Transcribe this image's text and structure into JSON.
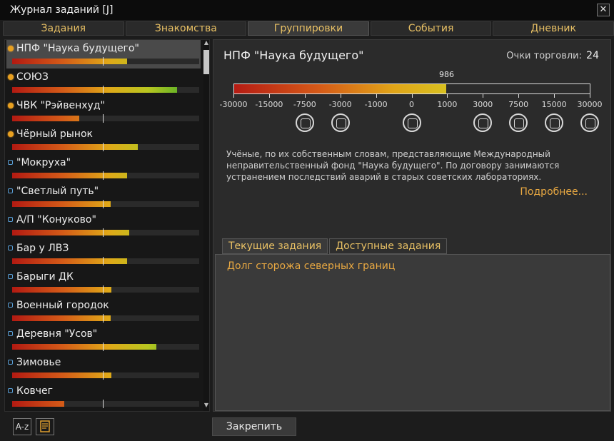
{
  "window": {
    "title": "Журнал заданий [J]",
    "close_glyph": "✕"
  },
  "tabs": [
    "Задания",
    "Знакомства",
    "Группировки",
    "События",
    "Дневник"
  ],
  "active_tab_index": 2,
  "factions": [
    {
      "name": "НПФ \"Наука будущего\"",
      "icon": "orange-gear-icon",
      "fill_pct": 61.5,
      "selected": true
    },
    {
      "name": "СОЮЗ",
      "icon": "orange-gear-icon",
      "fill_pct": 88
    },
    {
      "name": "ЧВК \"Рэйвенхуд\"",
      "icon": "orange-gear-icon",
      "fill_pct": 36
    },
    {
      "name": "Чёрный рынок",
      "icon": "orange-gear-icon",
      "fill_pct": 67
    },
    {
      "name": "\"Мокруха\"",
      "icon": "blue-house-icon",
      "fill_pct": 61.5
    },
    {
      "name": "\"Светлый путь\"",
      "icon": "blue-house-icon",
      "fill_pct": 52.5
    },
    {
      "name": "А/П \"Конуково\"",
      "icon": "blue-house-icon",
      "fill_pct": 62.5
    },
    {
      "name": "Бар у ЛВЗ",
      "icon": "blue-house-icon",
      "fill_pct": 61.5
    },
    {
      "name": "Барыги ДК",
      "icon": "blue-house-icon",
      "fill_pct": 53
    },
    {
      "name": "Военный городок",
      "icon": "blue-house-icon",
      "fill_pct": 52.5
    },
    {
      "name": "Деревня \"Усов\"",
      "icon": "blue-house-icon",
      "fill_pct": 77
    },
    {
      "name": "Зимовье",
      "icon": "blue-house-icon",
      "fill_pct": 53
    },
    {
      "name": "Ковчег",
      "icon": "blue-house-icon",
      "fill_pct": 28
    }
  ],
  "bottom_left": {
    "sort_label": "A-z",
    "filter_icon": "list-filter-icon"
  },
  "detail": {
    "title": "НПФ \"Наука будущего\"",
    "trade_label": "Очки торговли:",
    "trade_value": "24",
    "reputation": {
      "value": "986",
      "fill_pct": 59.6
    },
    "ticks": [
      {
        "label": "-30000",
        "pos": 0
      },
      {
        "label": "-15000",
        "pos": 10
      },
      {
        "label": "-7500",
        "pos": 20
      },
      {
        "label": "-3000",
        "pos": 30
      },
      {
        "label": "-1000",
        "pos": 40
      },
      {
        "label": "0",
        "pos": 50
      },
      {
        "label": "1000",
        "pos": 60
      },
      {
        "label": "3000",
        "pos": 70
      },
      {
        "label": "7500",
        "pos": 80
      },
      {
        "label": "15000",
        "pos": 90
      },
      {
        "label": "30000",
        "pos": 100
      }
    ],
    "rank_icons": [
      {
        "name": "skull-icon",
        "pos": 20
      },
      {
        "name": "biohazard-icon",
        "pos": 30
      },
      {
        "name": "handshake-icon",
        "pos": 50
      },
      {
        "name": "checklist-icon",
        "pos": 70
      },
      {
        "name": "trade-locked-icon",
        "pos": 80
      },
      {
        "name": "document-icon",
        "pos": 90
      },
      {
        "name": "ledger-icon",
        "pos": 100
      }
    ],
    "description": "Учёные, по их собственным словам, представляющие Международный неправительственный фонд \"Наука будущего\". По договору занимаются устранением последствий аварий в старых советских лабораториях.",
    "more_link": "Подробнее...",
    "task_tabs": [
      "Текущие задания",
      "Доступные задания"
    ],
    "active_task_tab_index": 0,
    "tasks": [
      "Долг сторожа северных границ"
    ]
  },
  "pin_button": "Закрепить"
}
